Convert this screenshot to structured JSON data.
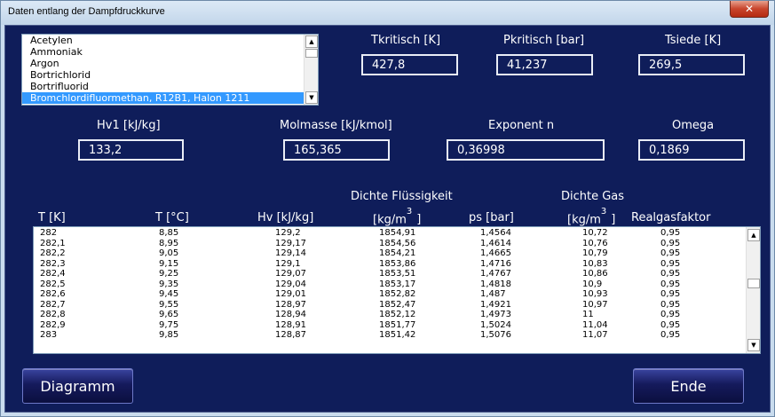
{
  "window": {
    "title": "Daten entlang der Dampfdruckkurve",
    "close_glyph": "✕"
  },
  "substances": {
    "items": [
      "Acetylen",
      "Ammoniak",
      "Argon",
      "Bortrichlorid",
      "Bortrifluorid",
      "Bromchlordifluormethan, R12B1, Halon 1211"
    ],
    "selected": "Bromchlordifluormethan, R12B1, Halon 1211"
  },
  "props": {
    "tkrit_label": "Tkritisch [K]",
    "tkrit_value": "427,8",
    "pkrit_label": "Pkritisch [bar]",
    "pkrit_value": "41,237",
    "tsiede_label": "Tsiede [K]",
    "tsiede_value": "269,5",
    "hv1_label": "Hv1 [kJ/kg]",
    "hv1_value": "133,2",
    "molmasse_label": "Molmasse [kJ/kmol]",
    "molmasse_value": "165,365",
    "exponent_label": "Exponent n",
    "exponent_value": "0,36998",
    "omega_label": "Omega",
    "omega_value": "0,1869"
  },
  "table": {
    "group_fluid": "Dichte Flüssigkeit",
    "group_gas": "Dichte Gas",
    "col_t_k": "T  [K]",
    "col_t_c": "T  [°C]",
    "col_hv": "Hv  [kJ/kg]",
    "col_rho_fl": "[kg/m",
    "col_ps": "ps [bar]",
    "col_rho_gas": "[kg/m",
    "col_real": "Realgasfaktor",
    "unit_sup": "3",
    "unit_close": "]",
    "rows": [
      [
        "282",
        "8,85",
        "129,2",
        "1854,91",
        "1,4564",
        "10,72",
        "0,95"
      ],
      [
        "282,1",
        "8,95",
        "129,17",
        "1854,56",
        "1,4614",
        "10,76",
        "0,95"
      ],
      [
        "282,2",
        "9,05",
        "129,14",
        "1854,21",
        "1,4665",
        "10,79",
        "0,95"
      ],
      [
        "282,3",
        "9,15",
        "129,1",
        "1853,86",
        "1,4716",
        "10,83",
        "0,95"
      ],
      [
        "282,4",
        "9,25",
        "129,07",
        "1853,51",
        "1,4767",
        "10,86",
        "0,95"
      ],
      [
        "282,5",
        "9,35",
        "129,04",
        "1853,17",
        "1,4818",
        "10,9",
        "0,95"
      ],
      [
        "282,6",
        "9,45",
        "129,01",
        "1852,82",
        "1,487",
        "10,93",
        "0,95"
      ],
      [
        "282,7",
        "9,55",
        "128,97",
        "1852,47",
        "1,4921",
        "10,97",
        "0,95"
      ],
      [
        "282,8",
        "9,65",
        "128,94",
        "1852,12",
        "1,4973",
        "11",
        "0,95"
      ],
      [
        "282,9",
        "9,75",
        "128,91",
        "1851,77",
        "1,5024",
        "11,04",
        "0,95"
      ],
      [
        "283",
        "9,85",
        "128,87",
        "1851,42",
        "1,5076",
        "11,07",
        "0,95"
      ]
    ]
  },
  "buttons": {
    "diagramm": "Diagramm",
    "ende": "Ende"
  },
  "icons": {
    "scroll_up": "▲",
    "scroll_down": "▼"
  }
}
